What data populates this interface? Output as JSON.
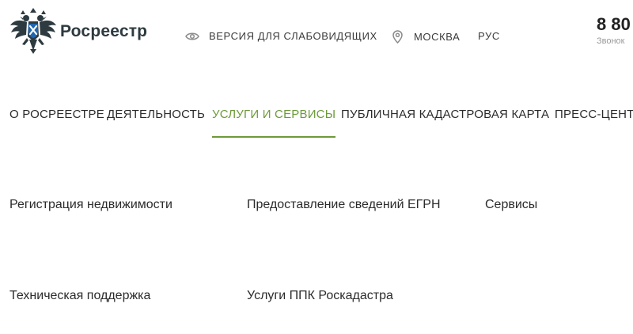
{
  "header": {
    "logo_text": "Росреестр",
    "vision_label": "ВЕРСИЯ ДЛЯ СЛАБОВИДЯЩИХ",
    "region_label": "МОСКВА",
    "lang_label": "РУС",
    "phone_number": "8 80",
    "phone_caption": "Звонок"
  },
  "nav": {
    "items": [
      {
        "label": "О РОСРЕЕСТРЕ"
      },
      {
        "label": "ДЕЯТЕЛЬНОСТЬ"
      },
      {
        "label": "УСЛУГИ И СЕРВИСЫ",
        "active": true
      },
      {
        "label": "ПУБЛИЧНАЯ КАДАСТРОВАЯ КАРТА"
      },
      {
        "label": "ПРЕСС-ЦЕНТР"
      }
    ]
  },
  "submenu": {
    "items": [
      {
        "label": "Регистрация недвижимости"
      },
      {
        "label": "Предоставление сведений ЕГРН"
      },
      {
        "label": "Сервисы"
      },
      {
        "label": "Техническая поддержка"
      },
      {
        "label": "Услуги ППК Роскадастра"
      }
    ]
  },
  "colors": {
    "accent_green": "#6d9a39",
    "logo_dark": "#2d3a40",
    "logo_blue": "#1f66b0"
  },
  "icons": {
    "logo": "double-headed-eagle-emblem",
    "vision": "eye-icon",
    "region": "location-pin-icon"
  }
}
